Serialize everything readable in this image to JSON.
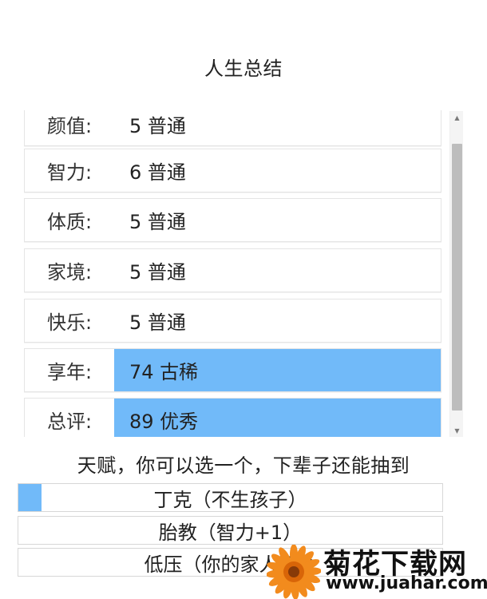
{
  "page": {
    "title": "人生总结"
  },
  "summary": {
    "rows": [
      {
        "label": "颜值:",
        "value": "5 普通",
        "highlight": false
      },
      {
        "label": "智力:",
        "value": "6 普通",
        "highlight": false
      },
      {
        "label": "体质:",
        "value": "5 普通",
        "highlight": false
      },
      {
        "label": "家境:",
        "value": "5 普通",
        "highlight": false
      },
      {
        "label": "快乐:",
        "value": "5 普通",
        "highlight": false
      },
      {
        "label": "享年:",
        "value": "74 古稀",
        "highlight": true
      },
      {
        "label": "总评:",
        "value": "89 优秀",
        "highlight": true
      }
    ]
  },
  "scroll": {
    "up_icon": "scroll-up-arrow-icon",
    "down_icon": "scroll-down-arrow-icon"
  },
  "talents": {
    "heading": "天赋，你可以选一个，下辈子还能抽到",
    "options": [
      {
        "label": "丁克（不生孩子）",
        "selected": true
      },
      {
        "label": "胎教（智力+1）",
        "selected": false
      },
      {
        "label": "低压（你的家人不会",
        "selected": false
      }
    ]
  },
  "watermark": {
    "title": "菊花下载网",
    "url": "www.juahar.com",
    "icon": "flower-icon",
    "color": "#f07b16"
  },
  "colors": {
    "accent": "#71baf9",
    "text": "#222222",
    "border": "#e5e5e5"
  }
}
